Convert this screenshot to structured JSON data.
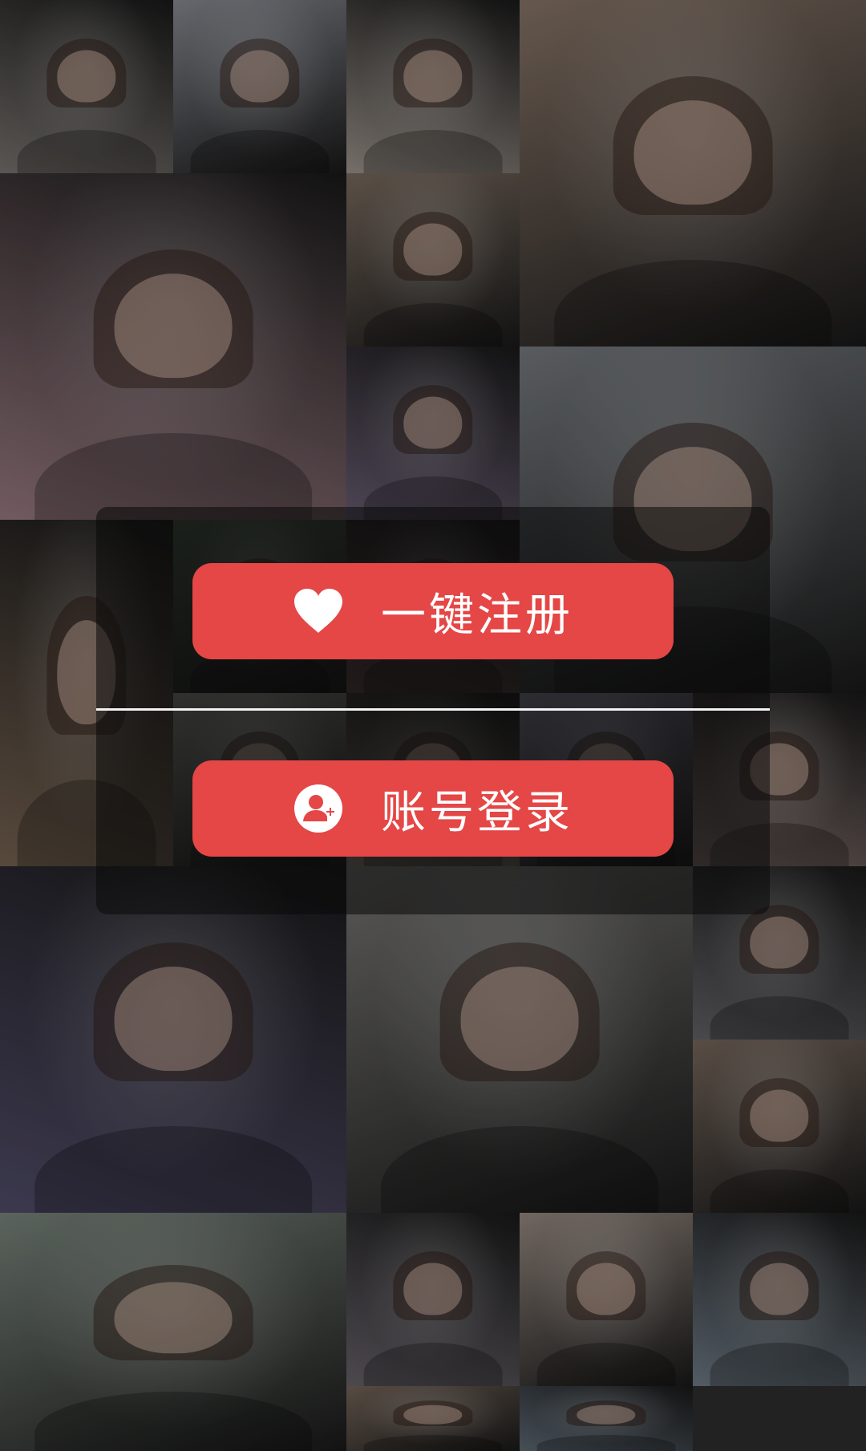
{
  "colors": {
    "accent": "#e54646",
    "panel": "rgba(10,10,10,0.55)",
    "divider": "#f2f2f2",
    "text": "#ffffff"
  },
  "background": {
    "photos": [
      {
        "size": "small",
        "tone": "#6e6a66"
      },
      {
        "size": "small",
        "tone": "#7d7f86"
      },
      {
        "size": "small",
        "tone": "#8f8780"
      },
      {
        "size": "big",
        "tone": "#7c6b5f"
      },
      {
        "size": "big",
        "tone": "#8a6f76"
      },
      {
        "size": "small",
        "tone": "#6f6257"
      },
      {
        "size": "small",
        "tone": "#5f5568"
      },
      {
        "size": "big",
        "tone": "#6c7074"
      },
      {
        "size": "tall",
        "tone": "#6b5a4a"
      },
      {
        "size": "small",
        "tone": "#3d4a3c"
      },
      {
        "size": "small",
        "tone": "#4c3b3a"
      },
      {
        "size": "small",
        "tone": "#777873"
      },
      {
        "size": "small",
        "tone": "#746a63"
      },
      {
        "size": "small",
        "tone": "#6b6a7a"
      },
      {
        "size": "big",
        "tone": "#4a4660"
      },
      {
        "size": "big",
        "tone": "#6d6c6a"
      },
      {
        "size": "small",
        "tone": "#736460"
      },
      {
        "size": "big",
        "tone": "#707a72"
      },
      {
        "size": "small",
        "tone": "#5a5a5e"
      },
      {
        "size": "small",
        "tone": "#6d5f55"
      },
      {
        "size": "small",
        "tone": "#5e5a60"
      },
      {
        "size": "small",
        "tone": "#8a7e76"
      },
      {
        "size": "small",
        "tone": "#65707a"
      },
      {
        "size": "small",
        "tone": "#6b5d52"
      },
      {
        "size": "small",
        "tone": "#55606a"
      }
    ]
  },
  "auth": {
    "register_label": "一键注册",
    "register_icon": "heart-icon",
    "login_label": "账号登录",
    "login_icon": "add-user-icon"
  }
}
